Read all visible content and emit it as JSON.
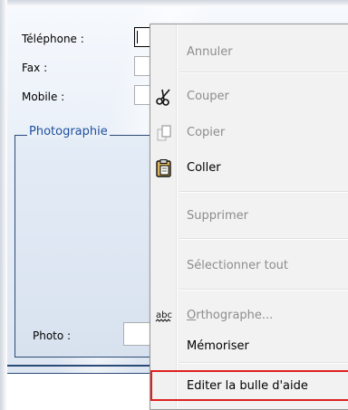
{
  "form": {
    "labels": {
      "telephone": "Téléphone :",
      "fax": "Fax :",
      "mobile": "Mobile :",
      "photo": "Photo :"
    },
    "group_title": "Photographie"
  },
  "context_menu": {
    "items": [
      {
        "label": "Annuler",
        "enabled": false,
        "icon": null
      },
      {
        "label": "Couper",
        "enabled": false,
        "icon": "scissors-icon"
      },
      {
        "label": "Copier",
        "enabled": false,
        "icon": "copy-icon"
      },
      {
        "label": "Coller",
        "enabled": true,
        "icon": "paste-icon"
      },
      {
        "label": "Supprimer",
        "enabled": false,
        "icon": null
      },
      {
        "label": "Sélectionner tout",
        "enabled": false,
        "icon": null
      },
      {
        "label": "Orthographe...",
        "enabled": false,
        "icon": "spelling-icon",
        "icon_text": "abc"
      },
      {
        "label": "Mémoriser",
        "enabled": true,
        "icon": null
      },
      {
        "label": "Editer la bulle d'aide",
        "enabled": true,
        "icon": null,
        "highlighted": true
      }
    ]
  },
  "colors": {
    "group_title": "#1e4f9f",
    "group_border": "#2c4a77",
    "disabled_text": "#8d8d8d",
    "highlight_border": "#e02020"
  }
}
